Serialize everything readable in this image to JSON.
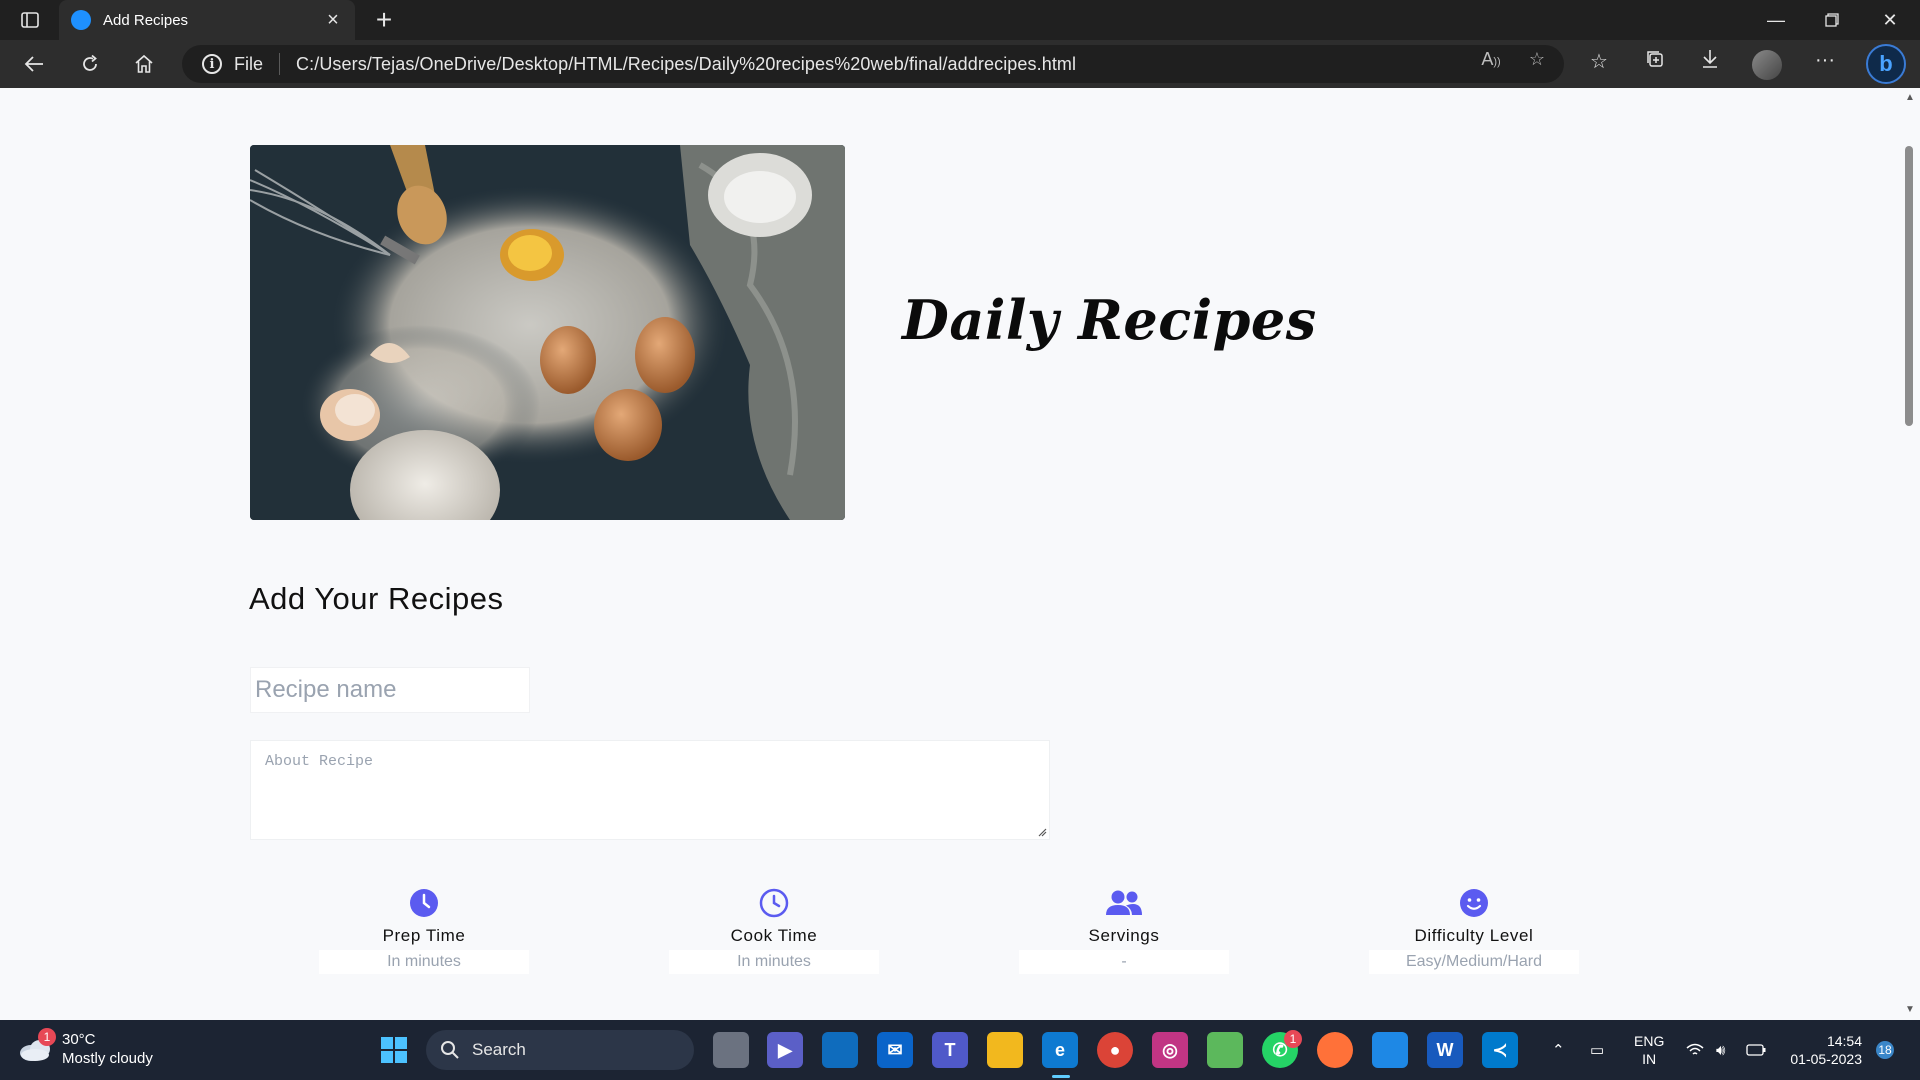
{
  "browser": {
    "tab_title": "Add Recipes",
    "new_tab": "+",
    "url_label": "File",
    "url": "C:/Users/Tejas/OneDrive/Desktop/HTML/Recipes/Daily%20recipes%20web/final/addrecipes.html"
  },
  "page": {
    "site_title": "Daily Recipes",
    "hero_image_alt": "Baking ingredients: flour, eggs, whisk and wooden spoon",
    "section_title": "Add Your Recipes",
    "recipe_name_placeholder": "Recipe name",
    "about_placeholder": "About Recipe",
    "meta": [
      {
        "label": "Prep Time",
        "placeholder": "In minutes",
        "icon": "clock-filled-icon"
      },
      {
        "label": "Cook Time",
        "placeholder": "In minutes",
        "icon": "clock-outline-icon"
      },
      {
        "label": "Servings",
        "placeholder": "-",
        "icon": "users-icon"
      },
      {
        "label": "Difficulty Level",
        "placeholder": "Easy/Medium/Hard",
        "icon": "smile-icon"
      }
    ],
    "accent_color": "#5b5bf0"
  },
  "taskbar": {
    "weather_temp": "30°C",
    "weather_desc": "Mostly cloudy",
    "weather_badge": "1",
    "search_label": "Search",
    "whatsapp_badge": "1",
    "lang_top": "ENG",
    "lang_bottom": "IN",
    "time": "14:54",
    "date": "01-05-2023",
    "notification_count": "18"
  }
}
